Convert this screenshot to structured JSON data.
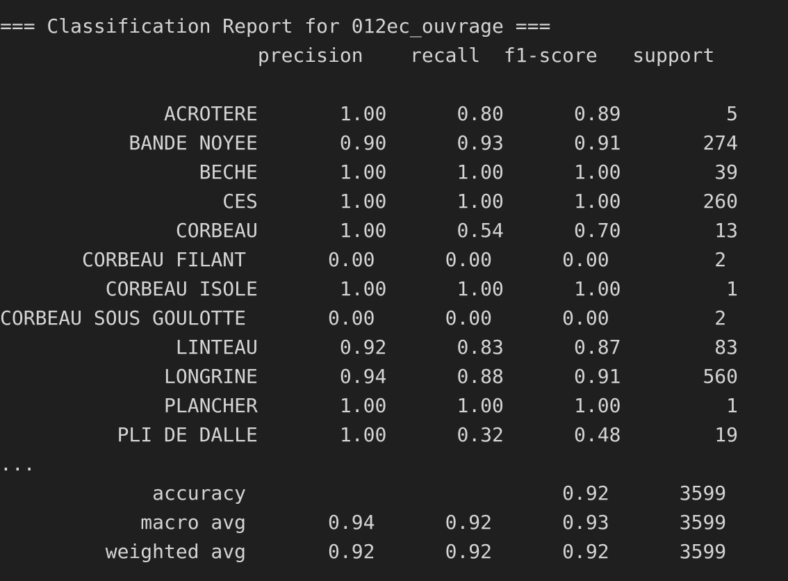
{
  "report": {
    "title_line": "=== Classification Report for 012ec_ouvrage ===",
    "header_line": "                      precision    recall  f1-score   support",
    "blank_line": "",
    "rows": [
      "              ACROTERE       1.00      0.80      0.89         5",
      "           BANDE NOYEE       0.90      0.93      0.91       274",
      "                 BECHE       1.00      1.00      1.00        39",
      "                   CES       1.00      1.00      1.00       260",
      "               CORBEAU       1.00      0.54      0.70        13",
      "       CORBEAU FILANT       0.00      0.00      0.00         2",
      "         CORBEAU ISOLE       1.00      1.00      1.00         1",
      "CORBEAU SOUS GOULOTTE       0.00      0.00      0.00         2",
      "               LINTEAU       0.92      0.83      0.87        83",
      "              LONGRINE       0.94      0.88      0.91       560",
      "              PLANCHER       1.00      1.00      1.00         1",
      "          PLI DE DALLE       1.00      0.32      0.48        19"
    ],
    "ellipsis_line": "...",
    "summary_rows": [
      "             accuracy                           0.92      3599",
      "            macro avg       0.94      0.92      0.93      3599",
      "         weighted avg       0.92      0.92      0.92      3599"
    ]
  }
}
